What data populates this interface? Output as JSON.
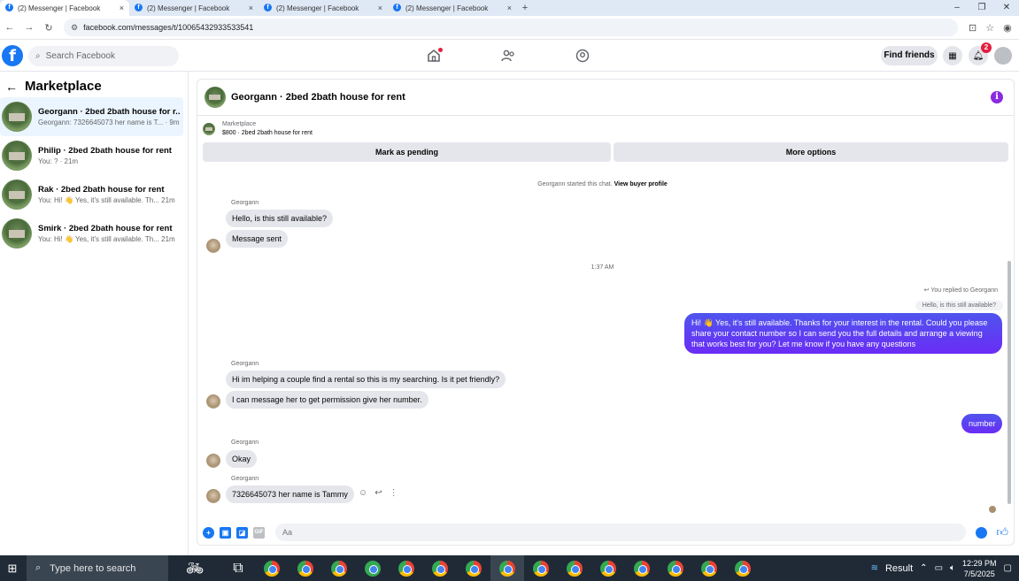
{
  "browser": {
    "tabs": [
      {
        "title": "(2) Messenger | Facebook",
        "close": "×"
      },
      {
        "title": "(2) Messenger | Facebook",
        "close": "×"
      },
      {
        "title": "(2) Messenger | Facebook",
        "close": "×"
      },
      {
        "title": "(2) Messenger | Facebook",
        "close": "×"
      }
    ],
    "new_tab": "+",
    "url": "facebook.com/messages/t/10065432933533541"
  },
  "header": {
    "search_placeholder": "Search Facebook",
    "find_friends": "Find friends",
    "notif_count": "2"
  },
  "sidebar": {
    "title": "Marketplace",
    "conversations": [
      {
        "name": "Georgann · 2bed 2bath house for r...",
        "preview": "Georgann: 7326645073 her name is T... · 9m"
      },
      {
        "name": "Philip · 2bed 2bath house for rent",
        "preview": "You: ? · 21m"
      },
      {
        "name": "Rak · 2bed 2bath house for rent",
        "preview": "You: Hi! 👋 Yes, it's still available. Th... 21m"
      },
      {
        "name": "Smirk · 2bed 2bath house for rent",
        "preview": "You: Hi! 👋 Yes, it's still available. Th... 21m"
      }
    ]
  },
  "chat": {
    "title": "Georgann · 2bed 2bath house for rent",
    "marketplace_label": "Marketplace",
    "listing": "$800 · 2bed 2bath house for rent",
    "mark_pending": "Mark as pending",
    "more_options": "More options",
    "started_text": "Georgann started this chat.",
    "view_profile": "View buyer profile",
    "sender": "Georgann",
    "msg1": "Hello, is this still available?",
    "msg2": "Message sent",
    "time": "1:37 AM",
    "replied_to": "You replied to Georgann",
    "quoted": "Hello, is this still available?",
    "out1": "Hi! 👋 Yes, it's still available. Thanks for your interest in the rental. Could you please share your contact number so I can send you the full details and arrange a viewing that works best for you? Let me know if you have any questions",
    "msg3": "Hi im helping a couple find a rental so this is my searching. Is it pet friendly?",
    "msg4": "I can message her to get permission give her number.",
    "out2": "number",
    "msg5": "Okay",
    "msg6": "7326645073 her name is Tammy",
    "composer_placeholder": "Aa"
  },
  "taskbar": {
    "search_placeholder": "Type here to search",
    "weather": "Result",
    "time": "12:29 PM",
    "date": "7/5/2025"
  }
}
